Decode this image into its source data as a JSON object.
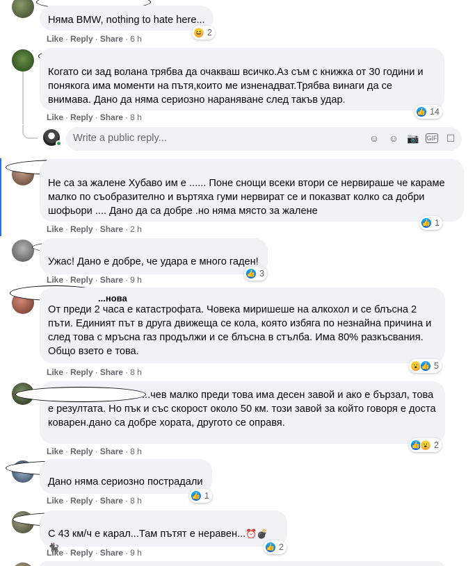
{
  "actions": {
    "like": "Like",
    "reply": "Reply",
    "share": "Share"
  },
  "reply_box": {
    "placeholder": "Write a public reply..."
  },
  "comments": [
    {
      "text": "Няма BMW, nothing to hate here...",
      "time": "6 h",
      "reaction_count": "2",
      "reactions": [
        "haha"
      ]
    },
    {
      "text": "Когато си зад волана трябва да очакваш всичко.Аз съм с книжка от 30 години и понякога има моменти на пътя,които ме изненадват.Трябва винаги да се внимава. Дано да няма сериозно нараняване след такъв удар.",
      "time": "8 h",
      "reaction_count": "14",
      "reactions": [
        "like"
      ]
    },
    {
      "text": "Не са за жалене Хубаво им е ...... Поне снощи всеки втори се нервираше че караме малко по съобразително и въртяха гуми нервират се и показват колко са добри шофьори .... Дано да са добре .но няма място за жалене",
      "time": "2 h",
      "reaction_count": "1",
      "reactions": [
        "like"
      ]
    },
    {
      "text": "Ужас! Дано е добре, че удара е много гаден!",
      "time": "9 h",
      "reaction_count": "3",
      "reactions": [
        "like"
      ]
    },
    {
      "name": "...нова",
      "text": "От преди 2 часа е катастрофата. Човека миришеше на алкохол и се блъсна 2 пъти. Единият път в друга движеща се кола, която избяга по незнайна причина и след това с мръсна газ продължи и се блъсна в стълба. Има 80% разкъсвания. Общо взето е това.",
      "time": "8 h",
      "reaction_count": "5",
      "reactions": [
        "wow",
        "like"
      ]
    },
    {
      "text_lead": "...чев",
      "text": "малко преди това има десен завой и ако е бързал, това е резултата. Но пък и със скорост около 50 км. този завой за който говоря е доста коварен.дано са добре хората, другото се оправя.",
      "time": "8 h",
      "reaction_count": "2",
      "reactions": [
        "like",
        "wow"
      ]
    },
    {
      "text": "Дано няма сериозно пострадали",
      "time": "8 h",
      "reaction_count": "1",
      "reactions": [
        "like"
      ]
    },
    {
      "text": "С 43 км/ч е карал...Там пътят е неравен...",
      "emojis": "⏰💣🐈‍⬛",
      "time": "9 h",
      "reaction_count": "2",
      "reactions": [
        "like"
      ]
    }
  ]
}
